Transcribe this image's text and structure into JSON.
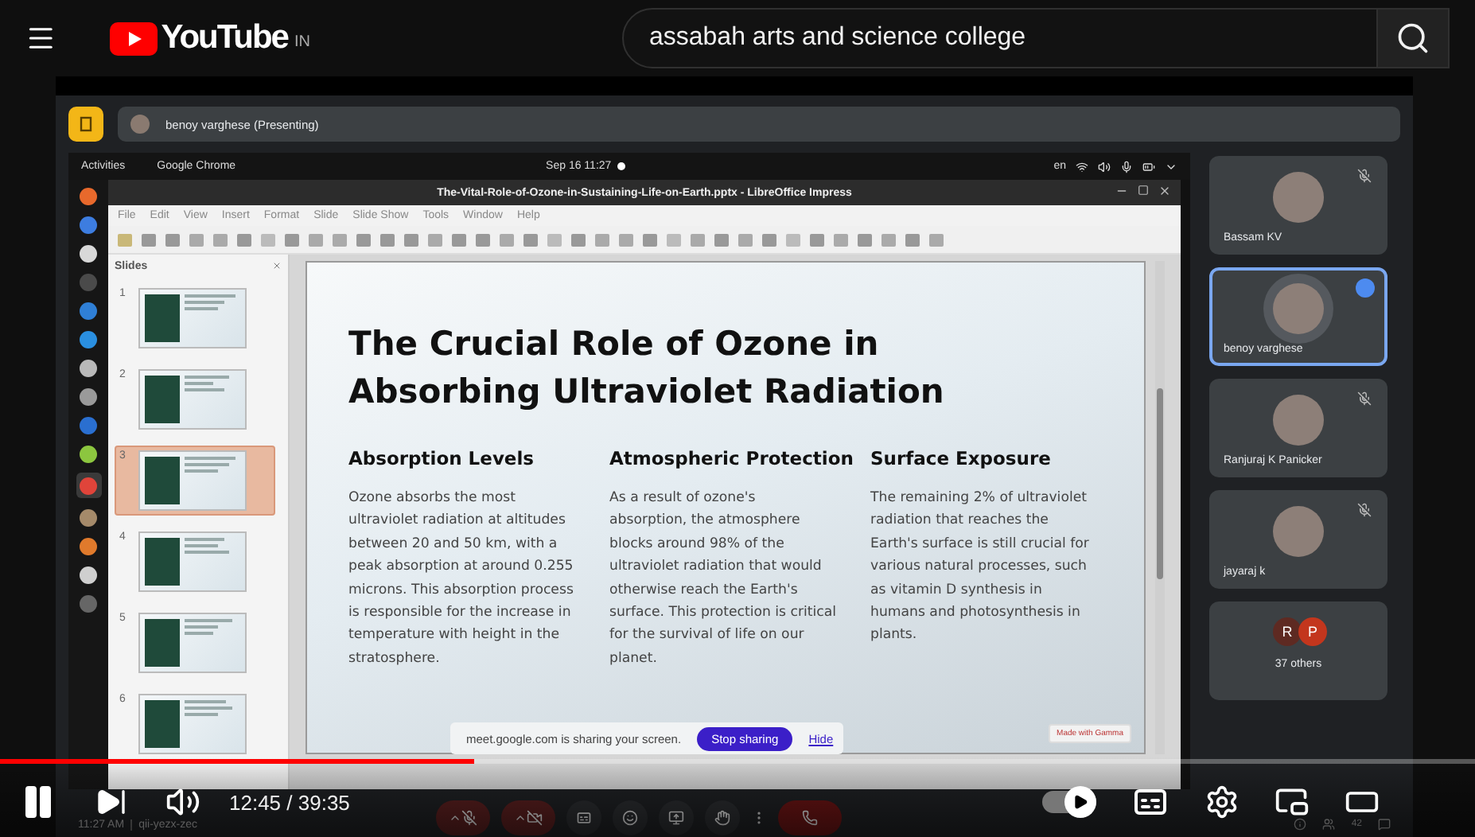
{
  "youtube": {
    "logo_text": "YouTube",
    "region": "IN",
    "search": {
      "value": "assabah arts and science college"
    }
  },
  "meet": {
    "presenter_bar": {
      "text": "benoy varghese (Presenting)"
    },
    "desktop": {
      "top_bar": {
        "activities": "Activities",
        "app": "Google Chrome",
        "clock": "Sep 16  11:27",
        "input_lang": "en"
      },
      "dock": [
        {
          "selected": false,
          "color": "#e8692c"
        },
        {
          "selected": false,
          "color": "#3d7de0"
        },
        {
          "selected": false,
          "color": "#d8d8d8"
        },
        {
          "selected": false,
          "color": "#4a4a4a"
        },
        {
          "selected": false,
          "color": "#2f7fd6"
        },
        {
          "selected": false,
          "color": "#2a8fe0"
        },
        {
          "selected": false,
          "color": "#b9b9b9"
        },
        {
          "selected": false,
          "color": "#9a9a9a"
        },
        {
          "selected": false,
          "color": "#2a6fd0"
        },
        {
          "selected": false,
          "color": "#8cc63f"
        },
        {
          "selected": true,
          "color": "#e0443a"
        },
        {
          "selected": false,
          "color": "#a58a6a"
        },
        {
          "selected": false,
          "color": "#e07a2c"
        },
        {
          "selected": false,
          "color": "#cfcfcf"
        },
        {
          "selected": false,
          "color": "#666666"
        }
      ],
      "impress": {
        "title": "The-Vital-Role-of-Ozone-in-Sustaining-Life-on-Earth.pptx - LibreOffice Impress",
        "menu": [
          "File",
          "Edit",
          "View",
          "Insert",
          "Format",
          "Slide",
          "Slide Show",
          "Tools",
          "Window",
          "Help"
        ],
        "slides_panel": {
          "title": "Slides",
          "slides": [
            {
              "number": "1",
              "selected": false
            },
            {
              "number": "2",
              "selected": false
            },
            {
              "number": "3",
              "selected": true
            },
            {
              "number": "4",
              "selected": false
            },
            {
              "number": "5",
              "selected": false
            },
            {
              "number": "6",
              "selected": false
            }
          ]
        },
        "slide": {
          "title": "The Crucial Role of Ozone in Absorbing Ultraviolet Radiation",
          "columns": [
            {
              "heading": "Absorption Levels",
              "body": "Ozone absorbs the most ultraviolet radiation at altitudes between 20 and 50 km, with a peak absorption at around 0.255 microns. This absorption process is responsible for the increase in temperature with height in the stratosphere."
            },
            {
              "heading": "Atmospheric Protection",
              "body": "As a result of ozone's absorption, the atmosphere blocks around 98% of the ultraviolet radiation that would otherwise reach the Earth's surface. This protection is critical for the survival of life on our planet."
            },
            {
              "heading": "Surface Exposure",
              "body": "The remaining 2% of ultraviolet radiation that reaches the Earth's surface is still crucial for various natural processes, such as vitamin D synthesis in humans and photosynthesis in plants."
            }
          ],
          "badge": "Made with Gamma"
        }
      }
    },
    "sharing_bar": {
      "text": "meet.google.com is sharing your screen.",
      "stop": "Stop sharing",
      "hide": "Hide"
    },
    "participants": [
      {
        "name": "Bassam KV",
        "muted": true,
        "speaking": false
      },
      {
        "name": "benoy varghese",
        "muted": false,
        "speaking": true
      },
      {
        "name": "Ranjuraj K Panicker",
        "muted": true,
        "speaking": false
      },
      {
        "name": "jayaraj k",
        "muted": true,
        "speaking": false
      }
    ],
    "others": {
      "initials": [
        {
          "letter": "R",
          "color": "#5e2a22"
        },
        {
          "letter": "P",
          "color": "#c3361d"
        }
      ],
      "label": "37 others"
    },
    "footer": {
      "time": "11:27 AM",
      "code": "qii-yezx-zec",
      "participant_count": "42"
    }
  },
  "player": {
    "level": 0.322,
    "time": "12:45 / 39:35",
    "autoplay": {
      "on": true
    }
  }
}
